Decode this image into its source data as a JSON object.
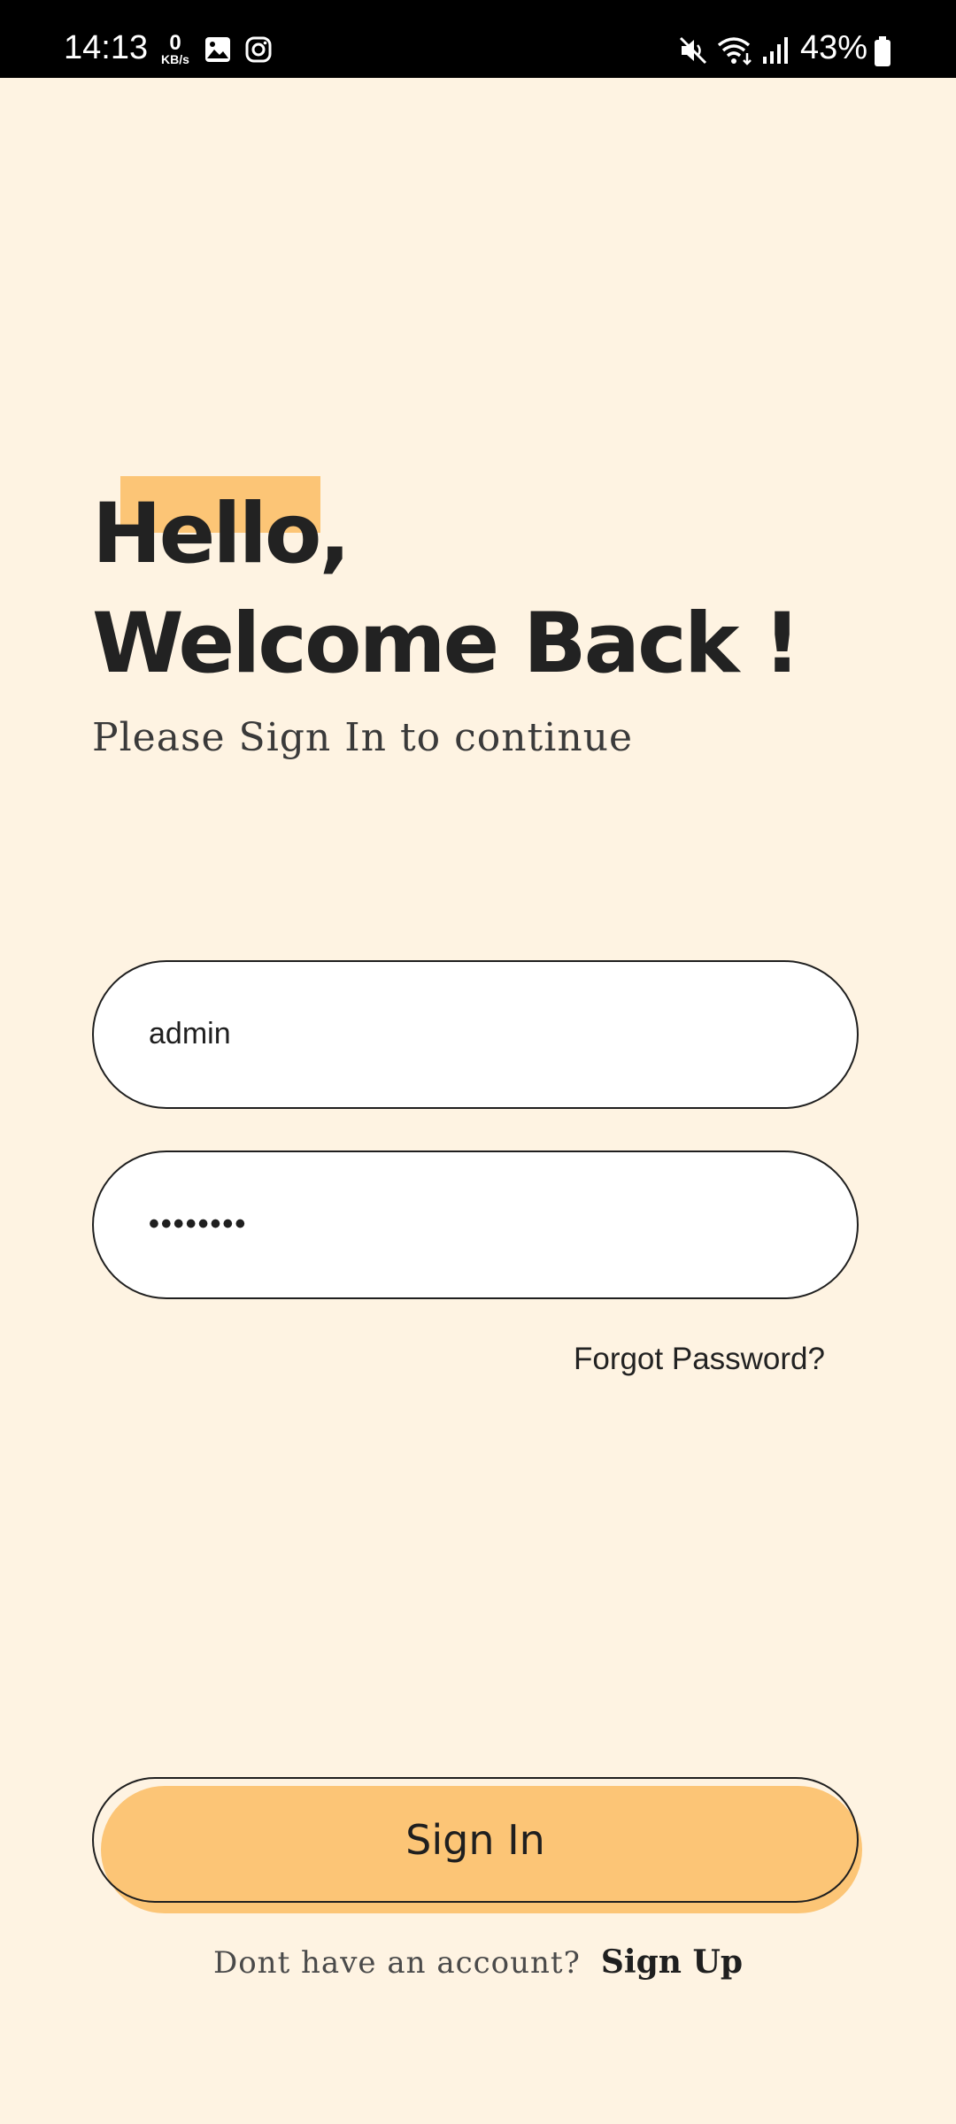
{
  "status_bar": {
    "time": "14:13",
    "net_speed_value": "0",
    "net_speed_unit": "KB/s",
    "battery": "43%",
    "icons": [
      "gallery-icon",
      "instagram-icon",
      "mute-icon",
      "wifi-icon",
      "signal-icon",
      "battery-icon"
    ]
  },
  "header": {
    "line1": "Hello,",
    "line2": "Welcome Back !",
    "subtitle": "Please Sign In to continue"
  },
  "form": {
    "username_value": "admin",
    "password_value": "••••••••",
    "forgot_label": "Forgot Password?"
  },
  "actions": {
    "signin_label": "Sign In",
    "signup_prompt": "Dont have an account?",
    "signup_label": "Sign Up"
  },
  "colors": {
    "background": "#FEF3E2",
    "accent": "#FCC576",
    "text": "#222222"
  }
}
